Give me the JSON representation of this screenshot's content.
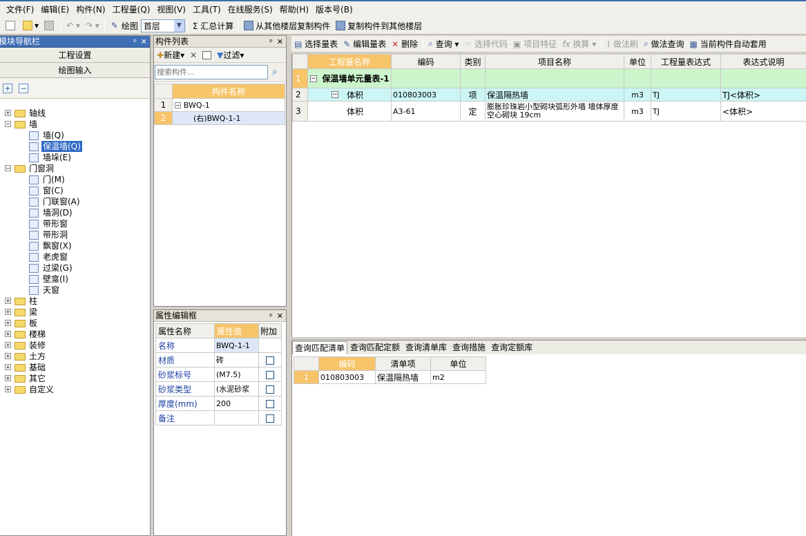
{
  "menu": [
    "文件(F)",
    "编辑(E)",
    "构件(N)",
    "工程量(Q)",
    "视图(V)",
    "工具(T)",
    "在线服务(S)",
    "帮助(H)",
    "版本号(B)"
  ],
  "toolbar": {
    "draw": "绘图",
    "floor": "首层",
    "sum": "Σ 汇总计算",
    "copy_from": "从其他楼层复制构件",
    "copy_to": "复制构件到其他楼层"
  },
  "nav": {
    "title": "模块导航栏",
    "project_settings": "工程设置",
    "drawing_input": "绘图输入",
    "tree": [
      {
        "label": "轴线",
        "level": 0,
        "expand": "+",
        "type": "folder"
      },
      {
        "label": "墙",
        "level": 0,
        "expand": "-",
        "type": "folder-open"
      },
      {
        "label": "墙(Q)",
        "level": 1,
        "type": "wall-icon"
      },
      {
        "label": "保温墙(Q)",
        "level": 1,
        "type": "insulation-wall-icon",
        "selected": true
      },
      {
        "label": "墙垛(E)",
        "level": 1,
        "type": "wall-pier-icon"
      },
      {
        "label": "门窗洞",
        "level": 0,
        "expand": "-",
        "type": "folder-open"
      },
      {
        "label": "门(M)",
        "level": 1,
        "type": "door-icon"
      },
      {
        "label": "窗(C)",
        "level": 1,
        "type": "window-icon"
      },
      {
        "label": "门联窗(A)",
        "level": 1,
        "type": "door-window-icon"
      },
      {
        "label": "墙洞(D)",
        "level": 1,
        "type": "wall-hole-icon"
      },
      {
        "label": "带形窗",
        "level": 1,
        "type": "strip-window-icon"
      },
      {
        "label": "带形洞",
        "level": 1,
        "type": "strip-hole-icon"
      },
      {
        "label": "飘窗(X)",
        "level": 1,
        "type": "bay-window-icon"
      },
      {
        "label": "老虎窗",
        "level": 1,
        "type": "dormer-icon"
      },
      {
        "label": "过梁(G)",
        "level": 1,
        "type": "lintel-icon"
      },
      {
        "label": "壁龛(I)",
        "level": 1,
        "type": "niche-icon"
      },
      {
        "label": "天窗",
        "level": 1,
        "type": "skylight-icon"
      },
      {
        "label": "柱",
        "level": 0,
        "expand": "+",
        "type": "folder"
      },
      {
        "label": "梁",
        "level": 0,
        "expand": "+",
        "type": "folder"
      },
      {
        "label": "板",
        "level": 0,
        "expand": "+",
        "type": "folder"
      },
      {
        "label": "楼梯",
        "level": 0,
        "expand": "+",
        "type": "folder"
      },
      {
        "label": "装修",
        "level": 0,
        "expand": "+",
        "type": "folder"
      },
      {
        "label": "土方",
        "level": 0,
        "expand": "+",
        "type": "folder"
      },
      {
        "label": "基础",
        "level": 0,
        "expand": "+",
        "type": "folder"
      },
      {
        "label": "其它",
        "level": 0,
        "expand": "+",
        "type": "folder"
      },
      {
        "label": "自定义",
        "level": 0,
        "expand": "+",
        "type": "folder"
      }
    ]
  },
  "components": {
    "title": "构件列表",
    "new": "新建",
    "filter": "过滤",
    "search_placeholder": "搜索构件...",
    "col_name": "构件名称",
    "rows": [
      {
        "num": "1",
        "name": "BWQ-1"
      },
      {
        "num": "2",
        "name": "(右)BWQ-1-1"
      }
    ]
  },
  "props": {
    "title": "属性编辑框",
    "col_name": "属性名称",
    "col_value": "属性值",
    "col_extra": "附加",
    "rows": [
      {
        "name": "名称",
        "value": "BWQ-1-1",
        "check": false
      },
      {
        "name": "材质",
        "value": "砖",
        "check": true
      },
      {
        "name": "砂浆标号",
        "value": "(M7.5)",
        "check": true
      },
      {
        "name": "砂浆类型",
        "value": "(水泥砂浆",
        "check": true
      },
      {
        "name": "厚度(mm)",
        "value": "200",
        "check": true
      },
      {
        "name": "备注",
        "value": "",
        "check": true
      }
    ]
  },
  "qty_toolbar": {
    "select_table": "选择量表",
    "edit_table": "编辑量表",
    "delete": "删除",
    "query": "查询",
    "select_code": "选择代码",
    "feature": "项目特征",
    "convert": "换算",
    "method_brush": "做法刷",
    "method_query": "做法查询",
    "auto_apply": "当前构件自动套用"
  },
  "qty_table": {
    "headers": [
      "工程量名称",
      "编码",
      "类别",
      "项目名称",
      "单位",
      "工程量表达式",
      "表达式说明"
    ],
    "rows": [
      {
        "num": "1",
        "name": "保温墙单元量表-1",
        "code": "",
        "type": "",
        "item": "",
        "unit": "",
        "expr": "",
        "desc": ""
      },
      {
        "num": "2",
        "name": "体积",
        "code": "010803003",
        "type": "项",
        "item": "保温隔热墙",
        "unit": "m3",
        "expr": "TJ",
        "desc": "TJ<体积>"
      },
      {
        "num": "3",
        "name": "体积",
        "code": "A3-61",
        "type": "定",
        "item": "膨胀珍珠岩小型砌块弧形外墙 墙体厚度 空心砌块 19cm",
        "unit": "m3",
        "expr": "TJ",
        "desc": "<体积>"
      }
    ]
  },
  "bottom_tabs": [
    "查询匹配清单",
    "查询匹配定额",
    "查询清单库",
    "查询措施",
    "查询定额库"
  ],
  "match_table": {
    "headers": [
      "编码",
      "清单项",
      "单位"
    ],
    "rows": [
      {
        "num": "1",
        "code": "010803003",
        "item": "保温隔热墙",
        "unit": "m2"
      }
    ]
  }
}
